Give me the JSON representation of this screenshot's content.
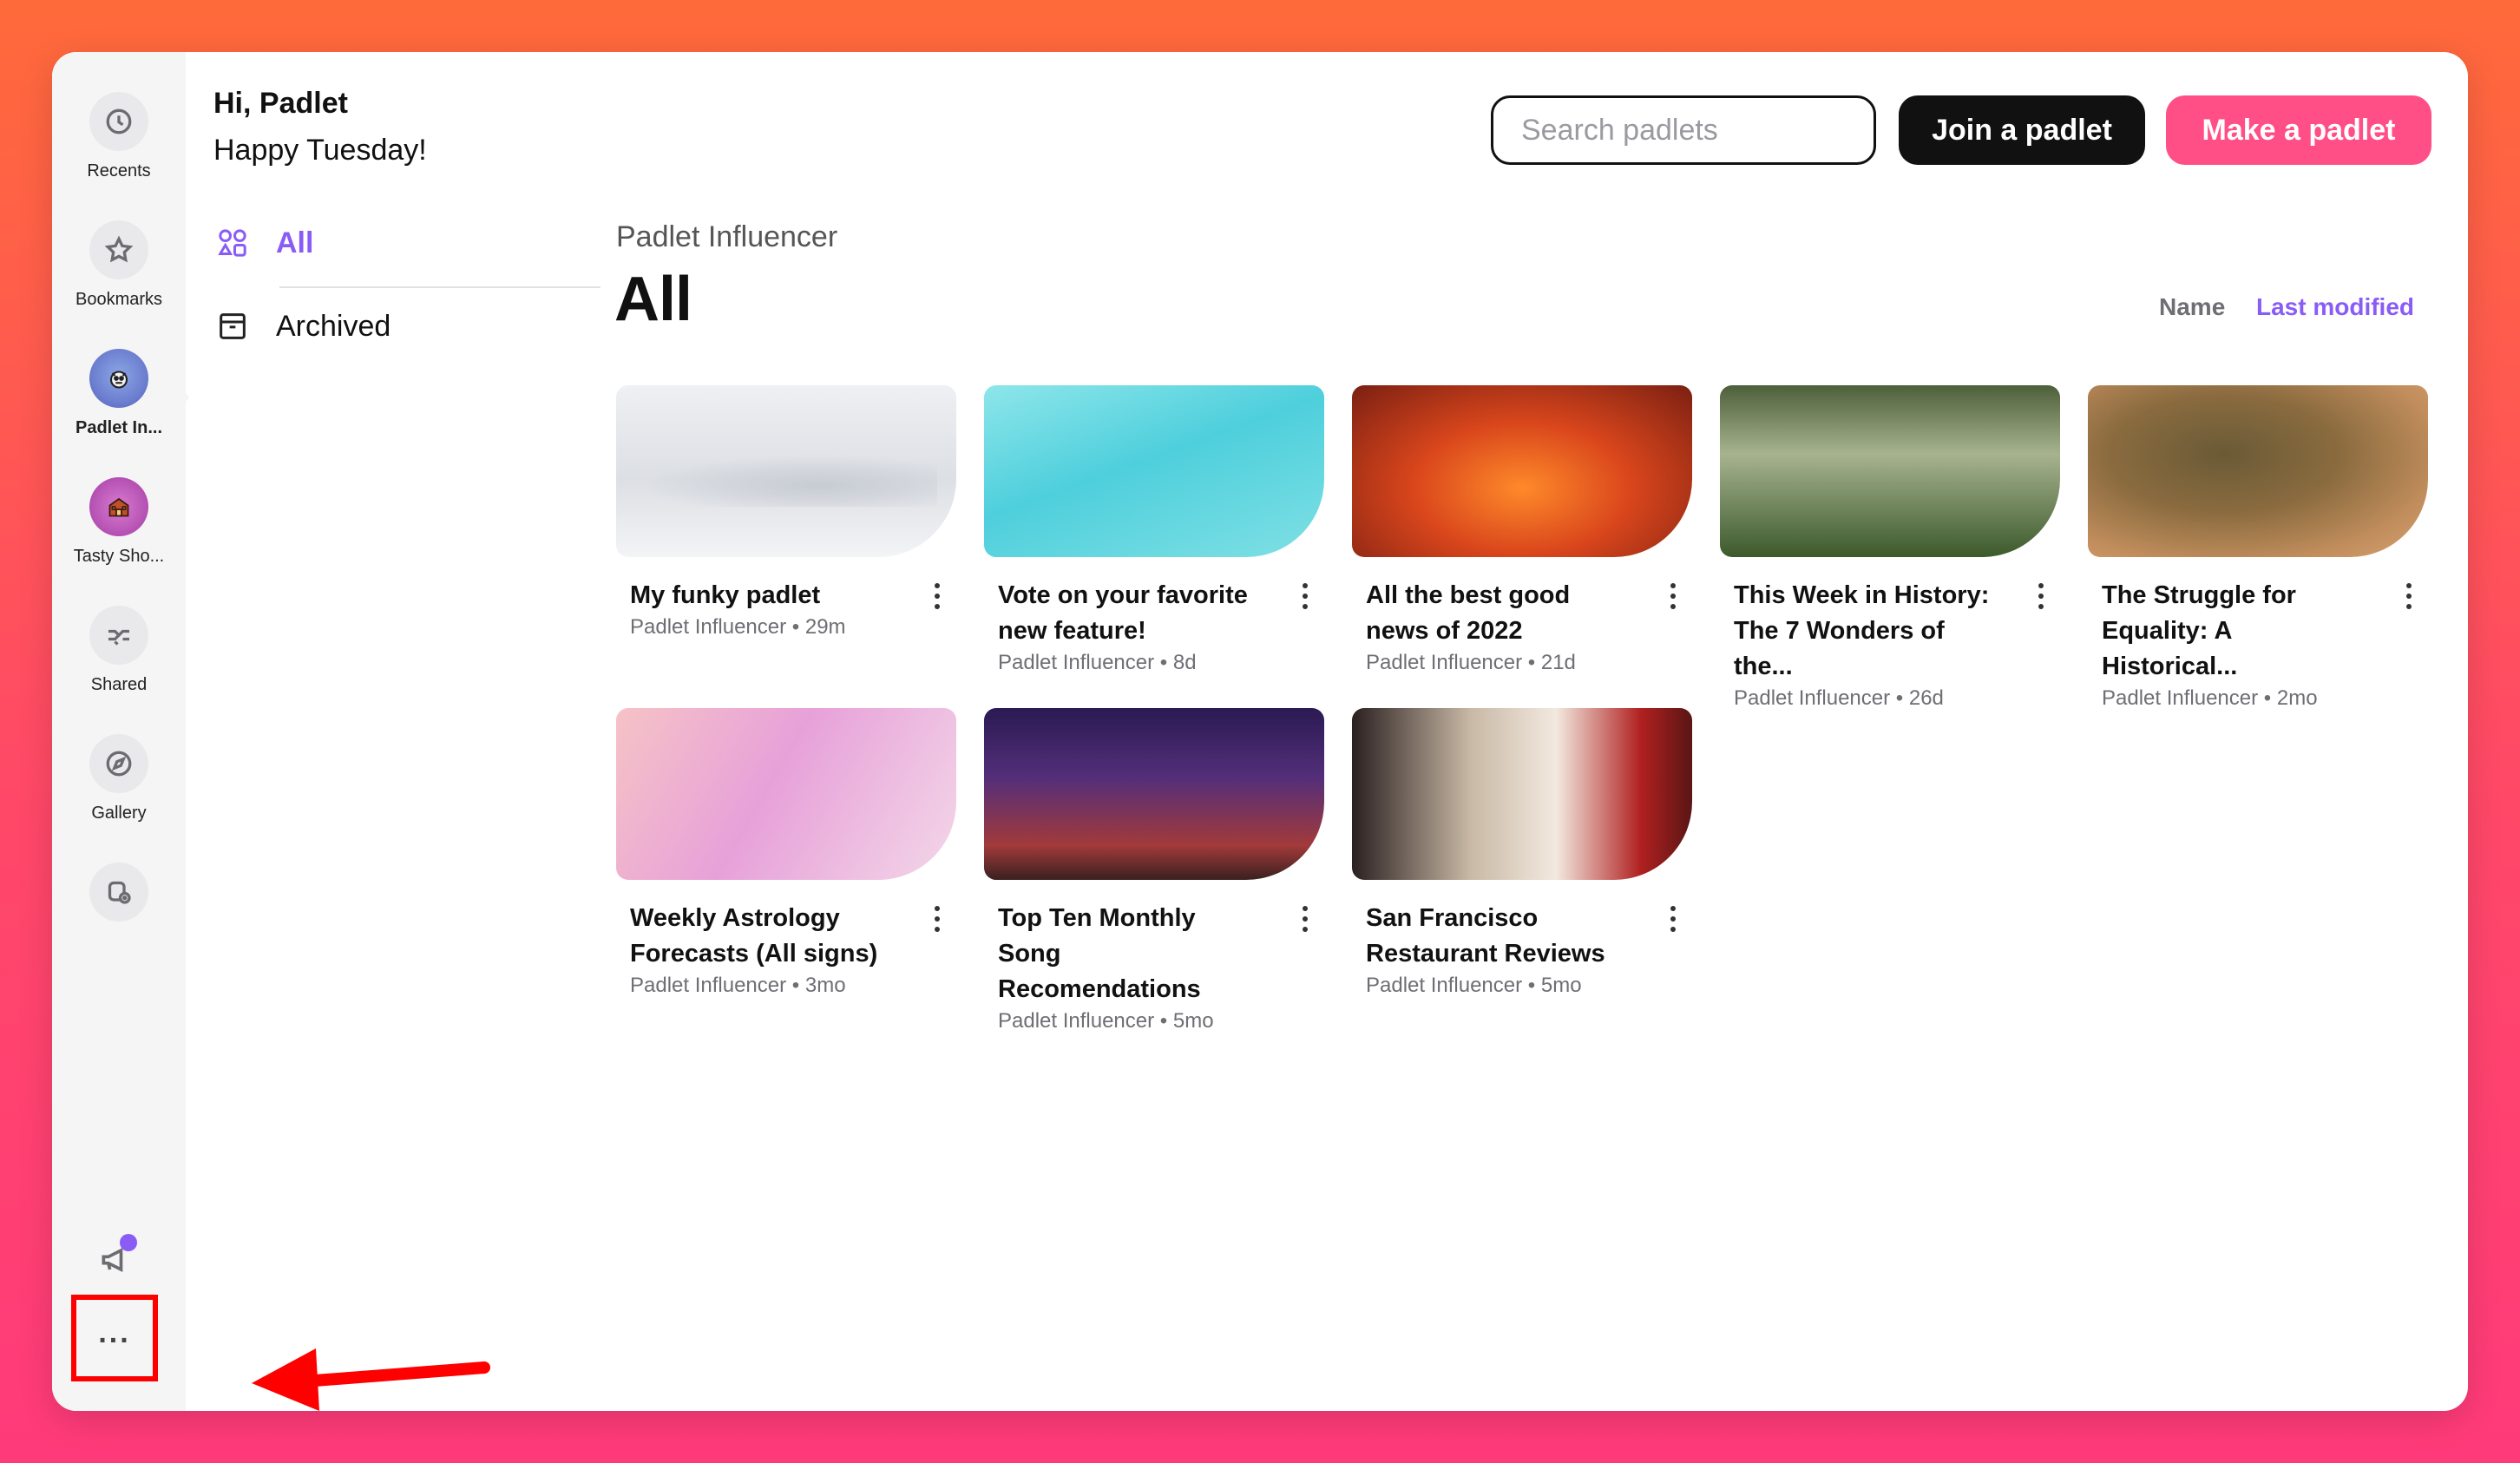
{
  "sidebar": {
    "items": [
      {
        "label": "Recents",
        "icon": "clock-icon"
      },
      {
        "label": "Bookmarks",
        "icon": "star-icon"
      },
      {
        "label": "Padlet In...",
        "icon": "avatar"
      },
      {
        "label": "Tasty Sho...",
        "icon": "avatar"
      },
      {
        "label": "Shared",
        "icon": "handshake-icon"
      },
      {
        "label": "Gallery",
        "icon": "compass-icon"
      },
      {
        "label": "",
        "icon": "new-folder-icon"
      }
    ],
    "bottom": {
      "announcement_icon": "megaphone-icon",
      "more_label": "..."
    }
  },
  "header": {
    "greeting": "Hi, Padlet",
    "subgreeting": "Happy Tuesday!",
    "search_placeholder": "Search padlets",
    "join_label": "Join a padlet",
    "make_label": "Make a padlet"
  },
  "nav": {
    "all_label": "All",
    "archived_label": "Archived"
  },
  "main": {
    "breadcrumb": "Padlet Influencer",
    "title": "All",
    "sort_name": "Name",
    "sort_modified": "Last modified",
    "cards": [
      {
        "title": "My funky padlet",
        "meta": "Padlet Influencer • 29m"
      },
      {
        "title": "Vote on your favorite new feature!",
        "meta": "Padlet Influencer • 8d"
      },
      {
        "title": "All the best good news of 2022",
        "meta": "Padlet Influencer • 21d"
      },
      {
        "title": "This Week in History: The 7 Wonders of the...",
        "meta": "Padlet Influencer • 26d"
      },
      {
        "title": "The Struggle for Equality: A Historical...",
        "meta": "Padlet Influencer • 2mo"
      },
      {
        "title": "Weekly Astrology Forecasts (All signs)",
        "meta": "Padlet Influencer • 3mo"
      },
      {
        "title": "Top Ten Monthly Song Recomendations",
        "meta": "Padlet Influencer • 5mo"
      },
      {
        "title": "San Francisco Restaurant Reviews",
        "meta": "Padlet Influencer • 5mo"
      }
    ]
  },
  "colors": {
    "accent": "#8a5cf6",
    "primary_button": "#ff4f86",
    "annotation": "#ff0000"
  }
}
